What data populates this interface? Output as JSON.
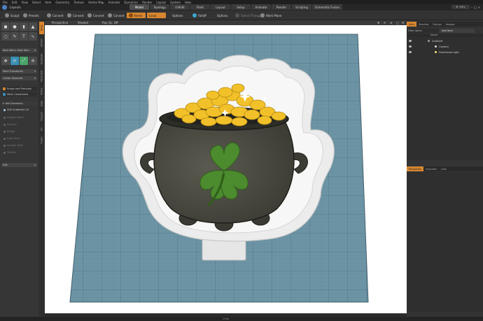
{
  "window": {
    "title": "Layouts"
  },
  "menu": [
    "File",
    "Edit",
    "View",
    "Select",
    "Item",
    "Geometry",
    "Texture",
    "Vertex Map",
    "Animate",
    "Dynamics",
    "Render",
    "Layout",
    "System",
    "Help"
  ],
  "layout_tabs": [
    {
      "label": "Model",
      "active": true
    },
    {
      "label": "Topology"
    },
    {
      "label": "UVEdit"
    },
    {
      "label": "Paint"
    },
    {
      "label": "Layout"
    },
    {
      "label": "Setup"
    },
    {
      "label": "Animate"
    },
    {
      "label": "Render"
    },
    {
      "label": "Scripting"
    },
    {
      "label": "Schematic Fusion"
    }
  ],
  "window_controls": {
    "only_label": "Only"
  },
  "toolbar": {
    "sculpt": "Sculpt",
    "presets": "Presets",
    "convert1": "Convert",
    "convert2": "Convert",
    "convert3": "Convert",
    "convert4": "Convert",
    "items": "Items",
    "local": "Local",
    "options1": "Options",
    "falloff": "Falloff",
    "options2": "Options",
    "select_through": "Select Through",
    "work_plane": "Work Plane"
  },
  "viewport_header": {
    "perspective": "Perspective",
    "shaded": "Shaded",
    "ray_gl": "Ray GL: Off"
  },
  "left_panel": {
    "item_menu": "Item Menu: New Item",
    "more_transforms": "More Transforms",
    "center_selected": "Center Selected",
    "snaps": "Snaps and Precision",
    "mesh_constraints": "Mesh Constraints",
    "add_geometry": "Add Geometry",
    "items": [
      "SDS Subdivide 2X",
      "Polygon Bevel",
      "Extrude",
      "Bridge",
      "Edge Slice",
      "Smooth Shift",
      "Thicken"
    ],
    "edit_dropdown": "Edit"
  },
  "vertical_tabs": [
    "Basic",
    "Deform",
    "Duplicate",
    "Mesh Edit",
    "Vertex",
    "Edge",
    "Polygon",
    "UV",
    "Fusion"
  ],
  "right_panel": {
    "tabs": [
      "Item",
      "Shading",
      "Groups",
      "Images"
    ],
    "filter_label": "Filter Items",
    "add_item": "Add Item",
    "column_name": "Name",
    "items": [
      {
        "label": "Untitled*"
      },
      {
        "label": "Camera"
      },
      {
        "label": "Directional Light"
      }
    ],
    "bottom_tabs": [
      "Properties",
      "Channels",
      "Lists"
    ]
  },
  "status": {
    "text": "Undo"
  },
  "colors": {
    "accent": "#d8862f",
    "bg": "#2b2b2b",
    "grid_plane": "#6c94a4",
    "cutter": "#e9e9e9",
    "pot": "#4a4a42",
    "gold": "#f2c12a",
    "clover": "#4c8b2e"
  }
}
